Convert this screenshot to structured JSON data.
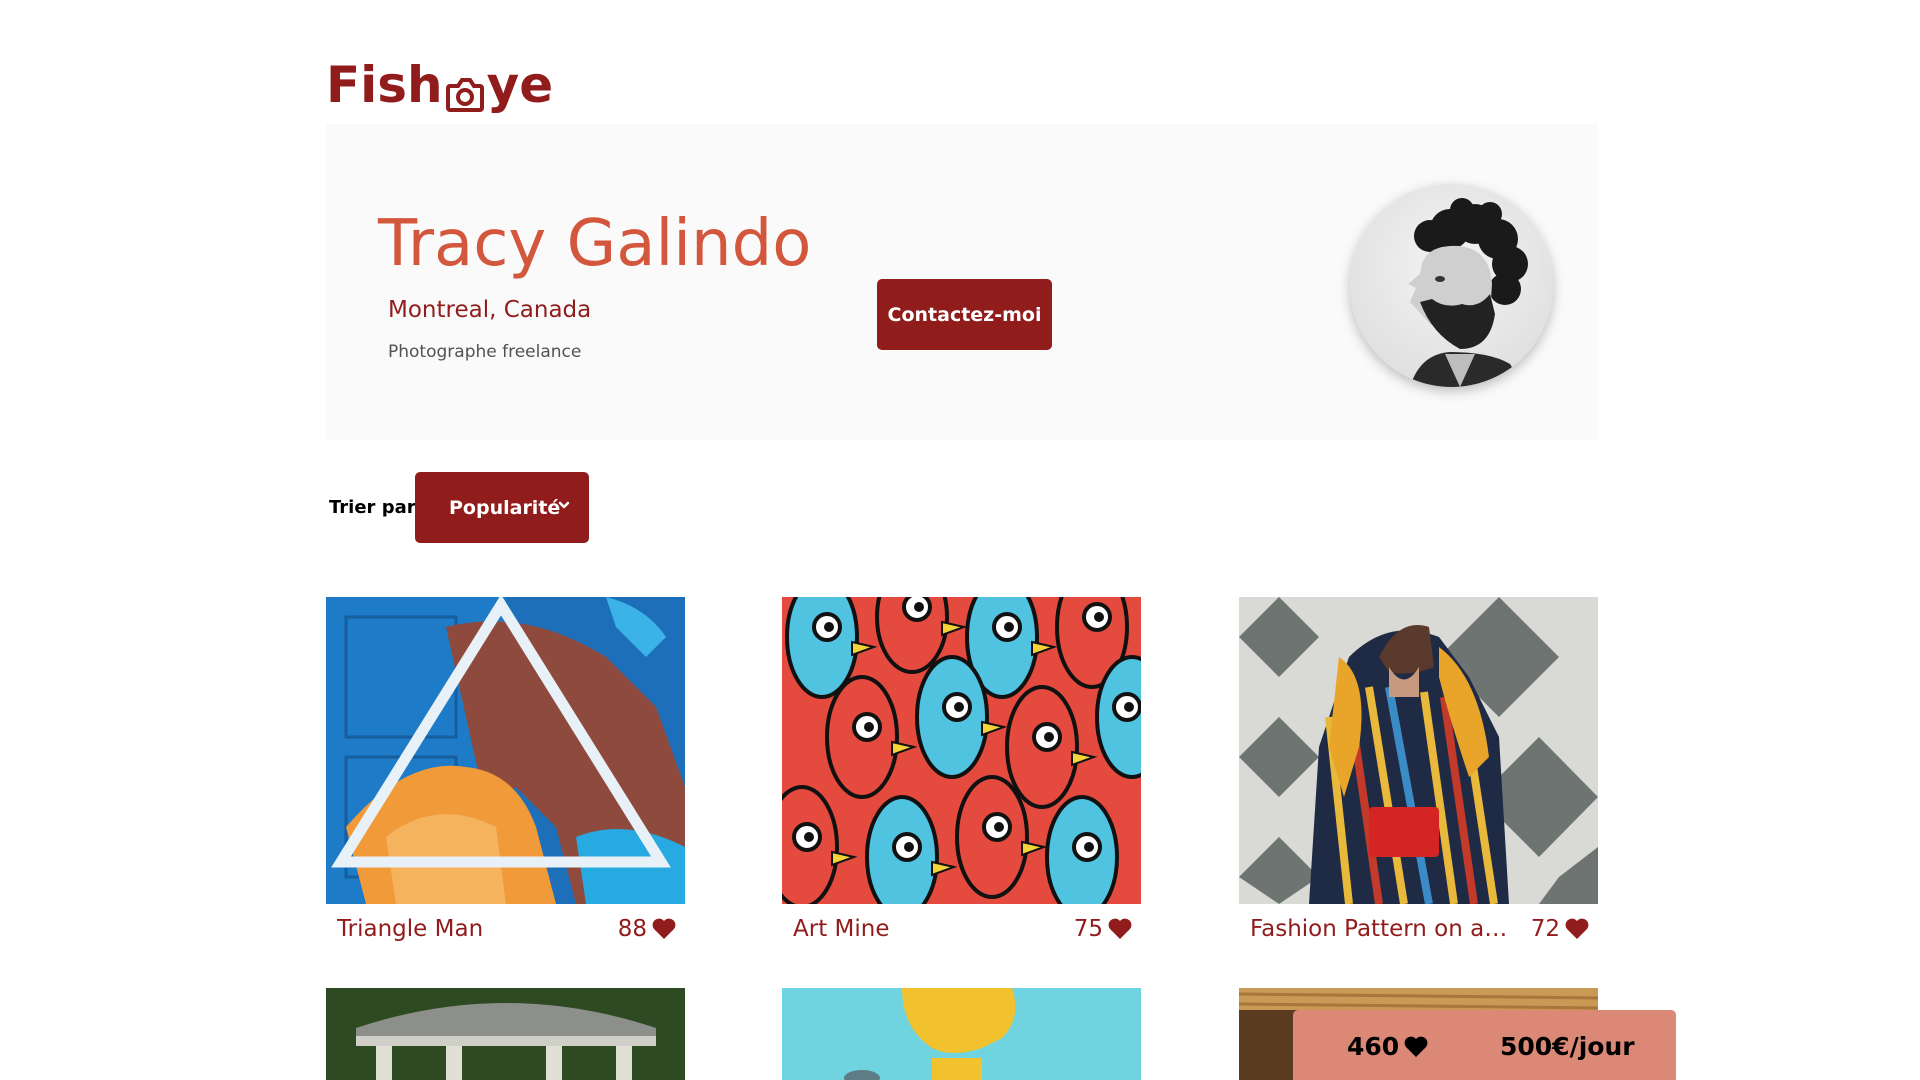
{
  "logo": {
    "text_before": "Fish",
    "text_after": "ye"
  },
  "photographer": {
    "name": "Tracy Galindo",
    "location": "Montreal, Canada",
    "tagline": "Photographe freelance",
    "contact_label": "Contactez-moi"
  },
  "sort": {
    "label": "Trier par",
    "selected": "Popularité"
  },
  "gallery": [
    {
      "title": "Triangle Man",
      "likes": "88"
    },
    {
      "title": "Art Mine",
      "likes": "75"
    },
    {
      "title": "Fashion Pattern on a P...",
      "likes": "72"
    },
    {
      "title": "",
      "likes": ""
    },
    {
      "title": "",
      "likes": ""
    },
    {
      "title": "",
      "likes": ""
    }
  ],
  "sticky": {
    "total_likes": "460",
    "price": "500€/jour"
  },
  "colors": {
    "primary": "#901C1C",
    "secondary": "#D3573C",
    "sticky_bg": "#DB8876",
    "banner_bg": "#FAFAFA"
  },
  "icons": {
    "logo_camera": "camera-icon",
    "heart": "heart-icon",
    "chevron": "chevron-down-icon"
  }
}
